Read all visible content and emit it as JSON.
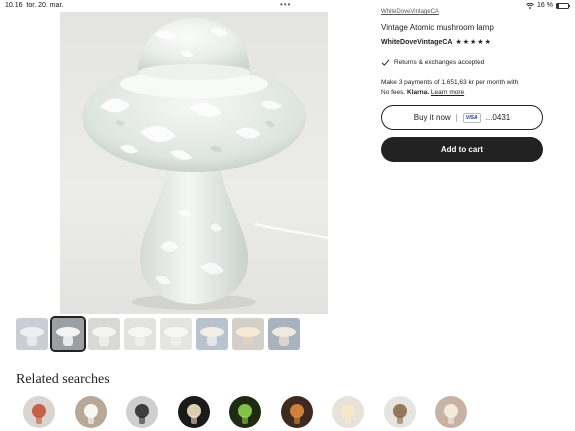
{
  "status_bar": {
    "time": "10.16",
    "date": "tor. 20. mar.",
    "dots": "•••",
    "battery_text": "16 %",
    "battery_level": 0.16
  },
  "product": {
    "shop_label": "WhiteDoveVintageCA",
    "title": "Vintage Atomic mushroom lamp",
    "shop_name": "WhiteDoveVintageCA",
    "star_count": 5,
    "stars": [
      "★",
      "★",
      "★",
      "★",
      "★"
    ],
    "returns_text": "Returns & exchanges accepted",
    "klarna_line1": "Make 3 payments of 1.651,63 kr per month with",
    "klarna_nofees": "No fees.",
    "klarna_brand": "Klarna.",
    "klarna_learn": "Learn more",
    "buy_now_label": "Buy it now",
    "buy_now_sep": "|",
    "card_brand": "VISA",
    "card_last4": "...0431",
    "add_to_cart_label": "Add to cart"
  },
  "thumbnails": [
    {
      "selected": false,
      "bg": "#c9ced6",
      "top": "#eef0f2",
      "stem": "#e6e8ea"
    },
    {
      "selected": true,
      "bg": "#9aa0a3",
      "top": "#f2f4f3",
      "stem": "#e8ebea"
    },
    {
      "selected": false,
      "bg": "#d8d8d6",
      "top": "#f4f4f2",
      "stem": "#ececea"
    },
    {
      "selected": false,
      "bg": "#e2e2de",
      "top": "#f6f6f4",
      "stem": "#eeeeec"
    },
    {
      "selected": false,
      "bg": "#e4e4e2",
      "top": "#f7f7f5",
      "stem": "#ededeb"
    },
    {
      "selected": false,
      "bg": "#b9c3cf",
      "top": "#f3efe7",
      "stem": "#e4e7ea"
    },
    {
      "selected": false,
      "bg": "#d3cfca",
      "top": "#f6ead6",
      "stem": "#e0d2bf"
    },
    {
      "selected": false,
      "bg": "#a9b3bd",
      "top": "#efe9df",
      "stem": "#dcd6ce"
    }
  ],
  "related": {
    "title": "Related searches",
    "items": [
      {
        "bg": "#d9d4d0",
        "accent": "#c4553a"
      },
      {
        "bg": "#b8a89a",
        "accent": "#ffffff"
      },
      {
        "bg": "#cfcfcf",
        "accent": "#2c2c2c"
      },
      {
        "bg": "#1a1a1a",
        "accent": "#f2e3c2"
      },
      {
        "bg": "#1f2a12",
        "accent": "#8fd14f"
      },
      {
        "bg": "#3d2b1f",
        "accent": "#e08a3c"
      },
      {
        "bg": "#e8e3da",
        "accent": "#f6e7c4"
      },
      {
        "bg": "#e6e4e0",
        "accent": "#8a6b4a"
      },
      {
        "bg": "#c7b2a6",
        "accent": "#f7efe2"
      }
    ]
  }
}
